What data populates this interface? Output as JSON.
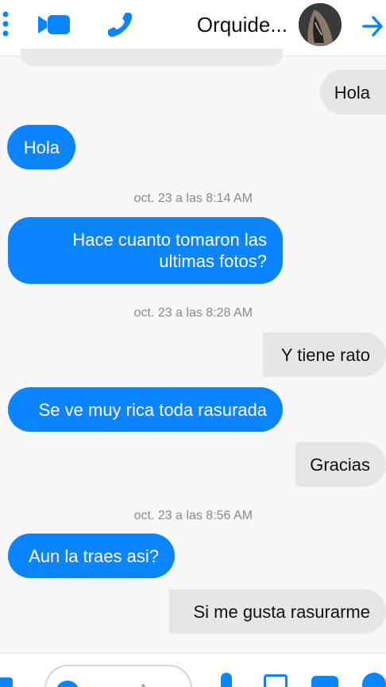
{
  "header": {
    "contact_name": "Orquide...",
    "icons": {
      "back": "back-arrow-icon",
      "call": "phone-icon",
      "video": "video-camera-icon",
      "menu": "more-vertical-icon"
    },
    "accent_color": "#0a84ff"
  },
  "thread": {
    "messages": [
      {
        "type": "incoming",
        "text": "Hola"
      },
      {
        "type": "outgoing",
        "text": "Hola"
      },
      {
        "type": "timestamp",
        "text": "oct. 23 a las 8:14 AM"
      },
      {
        "type": "outgoing",
        "text": "Hace cuanto tomaron las ultimas fotos?"
      },
      {
        "type": "timestamp",
        "text": "oct. 23 a las 8:28 AM"
      },
      {
        "type": "incoming",
        "text": "Y tiene rato"
      },
      {
        "type": "outgoing",
        "text": "Se ve muy rica toda rasurada"
      },
      {
        "type": "incoming",
        "text": "Gracias"
      },
      {
        "type": "timestamp",
        "text": "oct. 23 a las 8:56 AM"
      },
      {
        "type": "outgoing",
        "text": "Aun la traes asi?"
      },
      {
        "type": "incoming",
        "text": "Si me gusta rasurarme"
      }
    ]
  },
  "composer": {
    "placeholder": "Aa",
    "icons": [
      "plus-icon",
      "camera-icon",
      "gallery-icon",
      "microphone-icon",
      "emoji-icon",
      "like-icon"
    ]
  },
  "colors": {
    "outgoing_bubble": "#0a84ff",
    "incoming_bubble": "#e6e6e6",
    "background": "#f7f7f7"
  }
}
